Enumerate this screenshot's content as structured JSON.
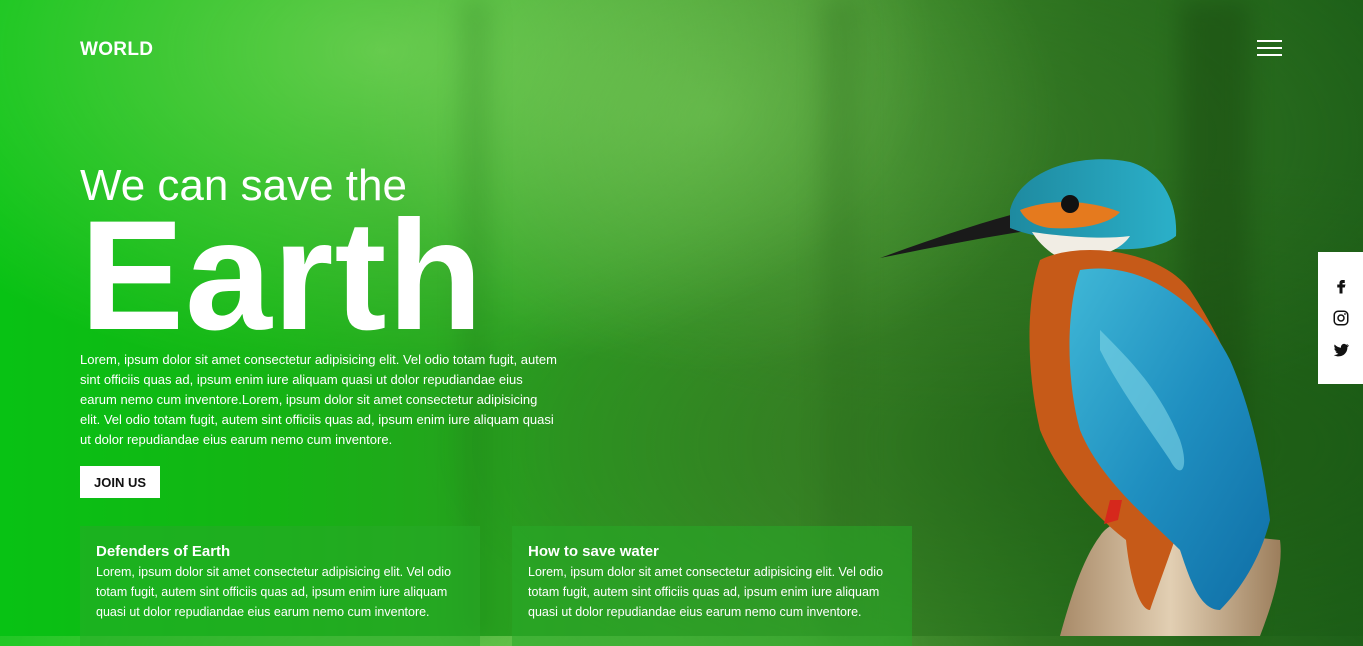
{
  "header": {
    "brand": "WORLD",
    "menu_icon": "hamburger-menu-icon"
  },
  "hero": {
    "subtitle": "We can save the",
    "title": "Earth",
    "text": "Lorem, ipsum dolor sit amet consectetur adipisicing elit. Vel odio totam fugit, autem sint officiis quas ad, ipsum enim iure aliquam quasi ut dolor repudiandae eius earum nemo cum inventore.Lorem, ipsum dolor sit amet consectetur adipisicing elit. Vel odio totam fugit, autem sint officiis quas ad, ipsum enim iure aliquam quasi ut dolor repudiandae eius earum nemo cum inventore.",
    "cta_label": "JOIN US"
  },
  "cards": [
    {
      "title": "Defenders of Earth",
      "text": "Lorem, ipsum dolor sit amet consectetur adipisicing elit. Vel odio totam fugit, autem sint officiis quas ad, ipsum enim iure aliquam quasi ut dolor repudiandae eius earum nemo cum inventore."
    },
    {
      "title": "How to save water",
      "text": "Lorem, ipsum dolor sit amet consectetur adipisicing elit. Vel odio totam fugit, autem sint officiis quas ad, ipsum enim iure aliquam quasi ut dolor repudiandae eius earum nemo cum inventore."
    }
  ],
  "social": {
    "icons": [
      "facebook-icon",
      "instagram-icon",
      "twitter-icon"
    ]
  },
  "colors": {
    "background_green": "#12b418",
    "card_bg": "#2aa82a",
    "text": "#ffffff"
  }
}
